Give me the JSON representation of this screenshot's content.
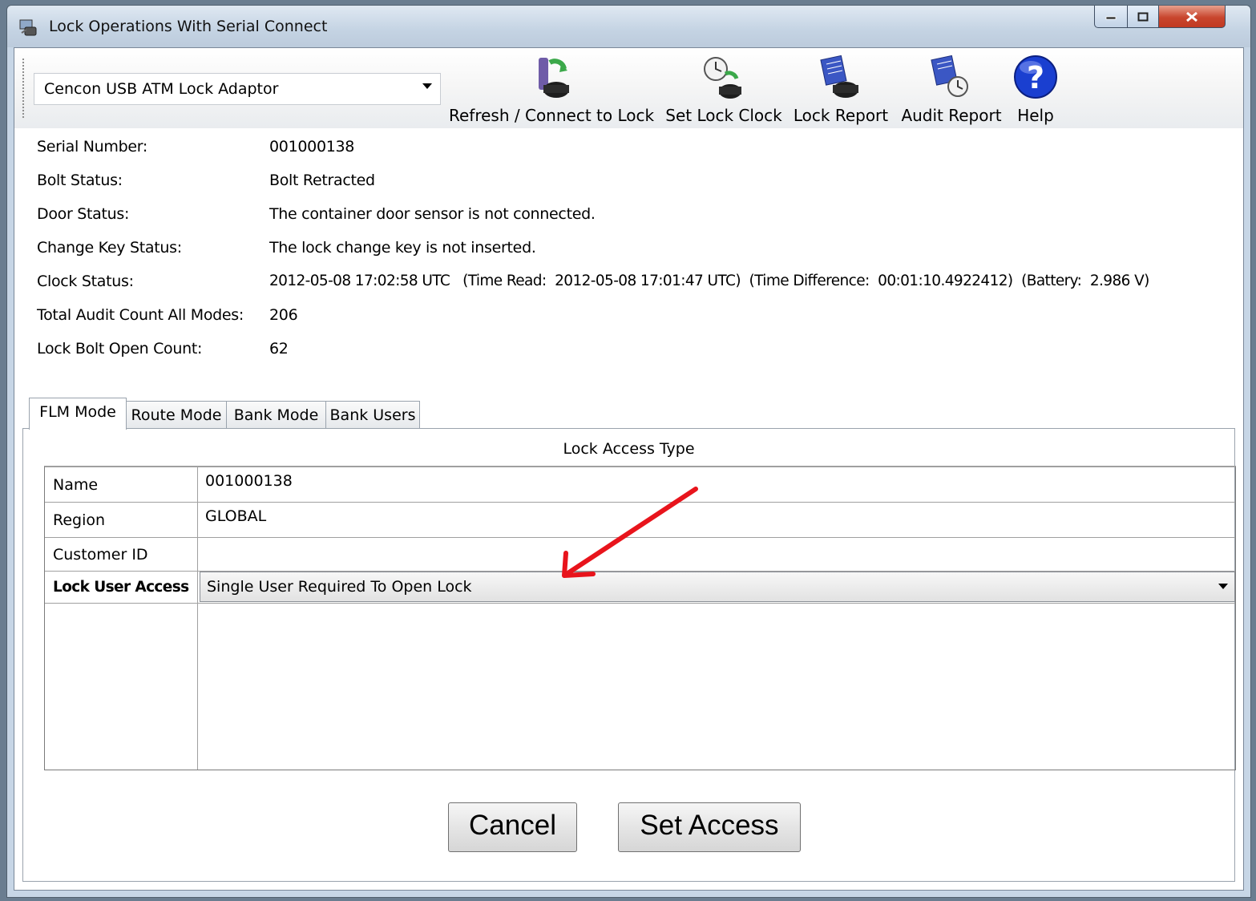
{
  "window": {
    "title": "Lock Operations With Serial Connect"
  },
  "toolbar": {
    "device_selected": "Cencon USB ATM Lock Adaptor",
    "buttons": [
      {
        "label": "Refresh / Connect to Lock",
        "icon": "refresh-connect-lock-icon"
      },
      {
        "label": "Set Lock Clock",
        "icon": "set-clock-icon"
      },
      {
        "label": "Lock Report",
        "icon": "lock-report-icon"
      },
      {
        "label": "Audit Report",
        "icon": "audit-report-icon"
      },
      {
        "label": "Help",
        "icon": "help-icon"
      }
    ]
  },
  "info": {
    "serial": {
      "label": "Serial Number:",
      "value": "001000138"
    },
    "bolt": {
      "label": "Bolt Status:",
      "value": "Bolt Retracted"
    },
    "door": {
      "label": "Door Status:",
      "value": "The container door sensor is not connected."
    },
    "change_key": {
      "label": "Change Key Status:",
      "value": "The lock change key is not inserted."
    },
    "clock": {
      "label": "Clock Status:",
      "value": "2012-05-08 17:02:58 UTC   (Time Read:  2012-05-08 17:01:47 UTC)  (Time Difference:  00:01:10.4922412)  (Battery:  2.986 V)"
    },
    "audit_count": {
      "label": "Total Audit Count All Modes:",
      "value": "206"
    },
    "bolt_open": {
      "label": "Lock Bolt Open Count:",
      "value": "62"
    }
  },
  "tabs": [
    "FLM Mode",
    "Route Mode",
    "Bank Mode",
    "Bank Users"
  ],
  "panel": {
    "title": "Lock Access Type",
    "rows": {
      "name": {
        "label": "Name",
        "value": "001000138"
      },
      "region": {
        "label": "Region",
        "value": "GLOBAL"
      },
      "customer": {
        "label": "Customer ID",
        "value": ""
      },
      "access": {
        "label": "Lock User Access",
        "value": "Single User Required To Open Lock"
      }
    }
  },
  "actions": {
    "cancel": "Cancel",
    "set_access": "Set Access"
  },
  "colors": {
    "annotation_arrow": "#e8141c",
    "help_icon": "#1a3fd0"
  }
}
